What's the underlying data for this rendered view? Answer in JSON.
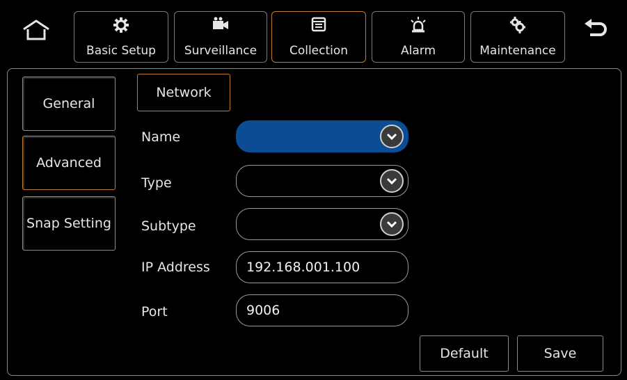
{
  "topbar": {
    "home_icon": "home-icon",
    "back_icon": "back-icon",
    "tabs": [
      {
        "label": "Basic Setup",
        "icon": "gear-icon"
      },
      {
        "label": "Surveillance",
        "icon": "camera-icon"
      },
      {
        "label": "Collection",
        "icon": "window-icon"
      },
      {
        "label": "Alarm",
        "icon": "siren-icon"
      },
      {
        "label": "Maintenance",
        "icon": "gears-icon"
      }
    ],
    "active_tab": "Collection"
  },
  "sidebar": {
    "items": [
      {
        "label": "General"
      },
      {
        "label": "Advanced"
      },
      {
        "label": "Snap Setting"
      }
    ],
    "active_item": "Advanced"
  },
  "section_tab": {
    "label": "Network"
  },
  "form": {
    "name_label": "Name",
    "type_label": "Type",
    "subtype_label": "Subtype",
    "ip_label": "IP Address",
    "ip_value": "192.168.001.100",
    "port_label": "Port",
    "port_value": "9006"
  },
  "actions": {
    "default_label": "Default",
    "save_label": "Save"
  },
  "colors": {
    "accent": "#c87f2d",
    "selected": "#0b4c95",
    "border": "#8d8d8d"
  }
}
